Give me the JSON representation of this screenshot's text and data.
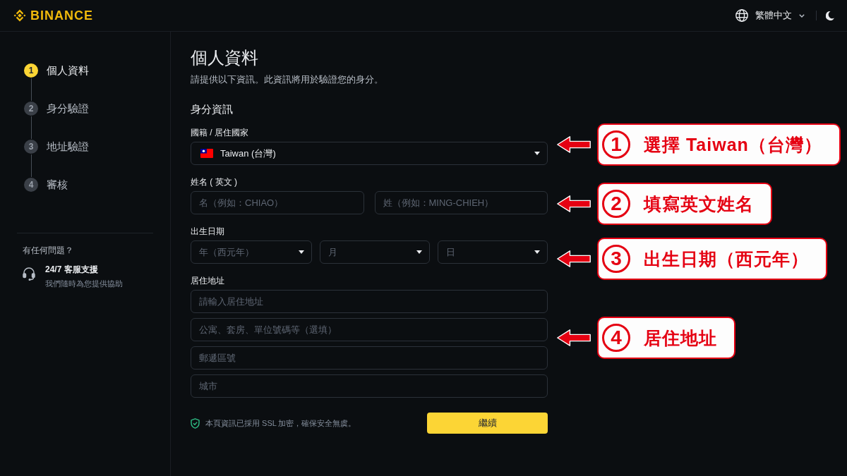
{
  "header": {
    "logo": "BINANCE",
    "language": "繁體中文"
  },
  "sidebar": {
    "steps": [
      {
        "number": "1",
        "label": "個人資料",
        "selected": true
      },
      {
        "number": "2",
        "label": "身分驗證",
        "selected": false
      },
      {
        "number": "3",
        "label": "地址驗證",
        "selected": false
      },
      {
        "number": "4",
        "label": "審核",
        "selected": false
      }
    ],
    "help": {
      "title": "有任何問題？",
      "support_title": "24/7 客服支援",
      "support_text": "我們隨時為您提供協助"
    }
  },
  "form": {
    "title": "個人資料",
    "subtitle": "請提供以下資訊。此資訊將用於驗證您的身分。",
    "section": "身分資訊",
    "groups": [
      {
        "label": "國籍 / 居住國家",
        "rows": [
          {
            "fields": [
              {
                "kind": "country-select",
                "value": "Taiwan (台灣)"
              }
            ]
          }
        ]
      },
      {
        "label": "姓名 ( 英文 )",
        "rows": [
          {
            "fields": [
              {
                "kind": "input",
                "placeholder": "名（例如：CHIAO）"
              },
              {
                "kind": "input",
                "placeholder": "姓（例如：MING-CHIEH）"
              }
            ]
          }
        ]
      },
      {
        "label": "出生日期",
        "rows": [
          {
            "fields": [
              {
                "kind": "select",
                "placeholder": "年（西元年）"
              },
              {
                "kind": "select",
                "placeholder": "月"
              },
              {
                "kind": "select",
                "placeholder": "日"
              }
            ]
          }
        ]
      },
      {
        "label": "居住地址",
        "rows": [
          {
            "fields": [
              {
                "kind": "input",
                "placeholder": "請輸入居住地址"
              }
            ]
          },
          {
            "fields": [
              {
                "kind": "input",
                "placeholder": "公寓、套房、單位號碼等（選填）"
              }
            ]
          },
          {
            "fields": [
              {
                "kind": "input",
                "placeholder": "郵遞區號"
              }
            ]
          },
          {
            "fields": [
              {
                "kind": "input",
                "placeholder": "城市"
              }
            ]
          }
        ]
      }
    ],
    "security_note": "本頁資訊已採用 SSL 加密，確保安全無虞。",
    "continue_button": "繼續"
  },
  "annotations": [
    {
      "number": "1",
      "text": "選擇 Taiwan（台灣）"
    },
    {
      "number": "2",
      "text": "填寫英文姓名"
    },
    {
      "number": "3",
      "text": "出生日期（西元年）"
    },
    {
      "number": "4",
      "text": "居住地址"
    }
  ]
}
